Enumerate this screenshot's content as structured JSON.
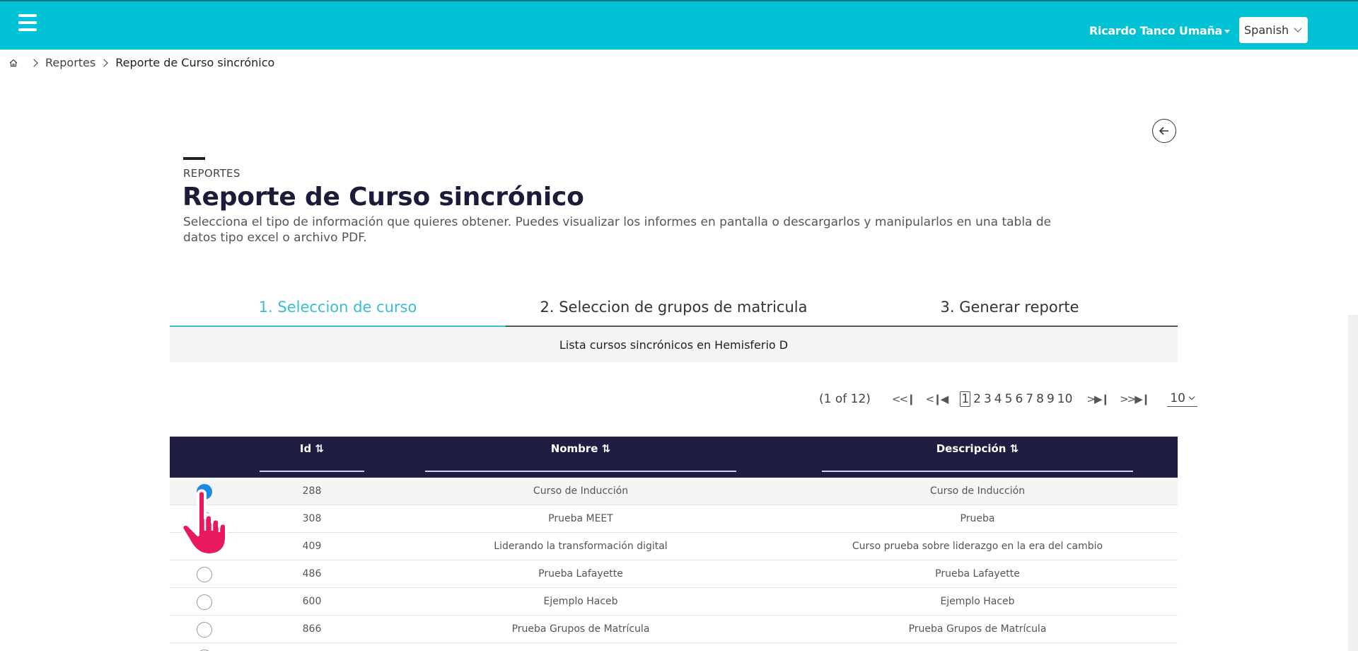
{
  "header": {
    "user_name": "Ricardo Tanco Umaña",
    "language": "Spanish"
  },
  "breadcrumb": {
    "items": [
      "Reportes",
      "Reporte de Curso sincrónico"
    ]
  },
  "page": {
    "eyebrow": "REPORTES",
    "title": "Reporte de Curso sincrónico",
    "description": "Selecciona el tipo de información que quieres obtener. Puedes visualizar los informes en pantalla o descargarlos y manipularlos en una tabla de datos tipo excel o archivo PDF."
  },
  "tabs": [
    {
      "label": "1. Seleccion de curso",
      "active": true
    },
    {
      "label": "2. Seleccion de grupos de matricula",
      "active": false
    },
    {
      "label": "3. Generar reporte",
      "active": false
    }
  ],
  "list_caption": "Lista cursos sincrónicos en Hemisferio D",
  "pagination": {
    "info": "(1 of 12)",
    "first": "<<",
    "prev": "<",
    "next": ">",
    "last": ">>",
    "pages": [
      "1",
      "2",
      "3",
      "4",
      "5",
      "6",
      "7",
      "8",
      "9",
      "10"
    ],
    "current_page": "1",
    "rows_per_page": "10"
  },
  "table": {
    "columns": [
      "Id",
      "Nombre",
      "Descripción"
    ],
    "rows": [
      {
        "id": "288",
        "nombre": "Curso de Inducción",
        "descripcion": "Curso de Inducción",
        "selected": true
      },
      {
        "id": "308",
        "nombre": "Prueba MEET",
        "descripcion": "Prueba",
        "selected": false
      },
      {
        "id": "409",
        "nombre": "Liderando la transformación digital",
        "descripcion": "Curso prueba sobre liderazgo en la era del cambio",
        "selected": false
      },
      {
        "id": "486",
        "nombre": "Prueba Lafayette",
        "descripcion": "Prueba Lafayette",
        "selected": false
      },
      {
        "id": "600",
        "nombre": "Ejemplo Haceb",
        "descripcion": "Ejemplo Haceb",
        "selected": false
      },
      {
        "id": "866",
        "nombre": "Prueba Grupos de Matrícula",
        "descripcion": "Prueba Grupos de Matrícula",
        "selected": false
      }
    ]
  },
  "colors": {
    "header_bg": "#00c2d4",
    "active_tab": "#39bdd2",
    "table_header_bg": "#1f1d42",
    "radio_checked": "#1e88e5",
    "cursor": "#e8195e"
  },
  "icons": {
    "menu": "hamburger-icon",
    "home": "home-icon",
    "back": "arrow-left-icon",
    "sort": "sort-icon",
    "cursor": "hand-pointer-icon"
  }
}
